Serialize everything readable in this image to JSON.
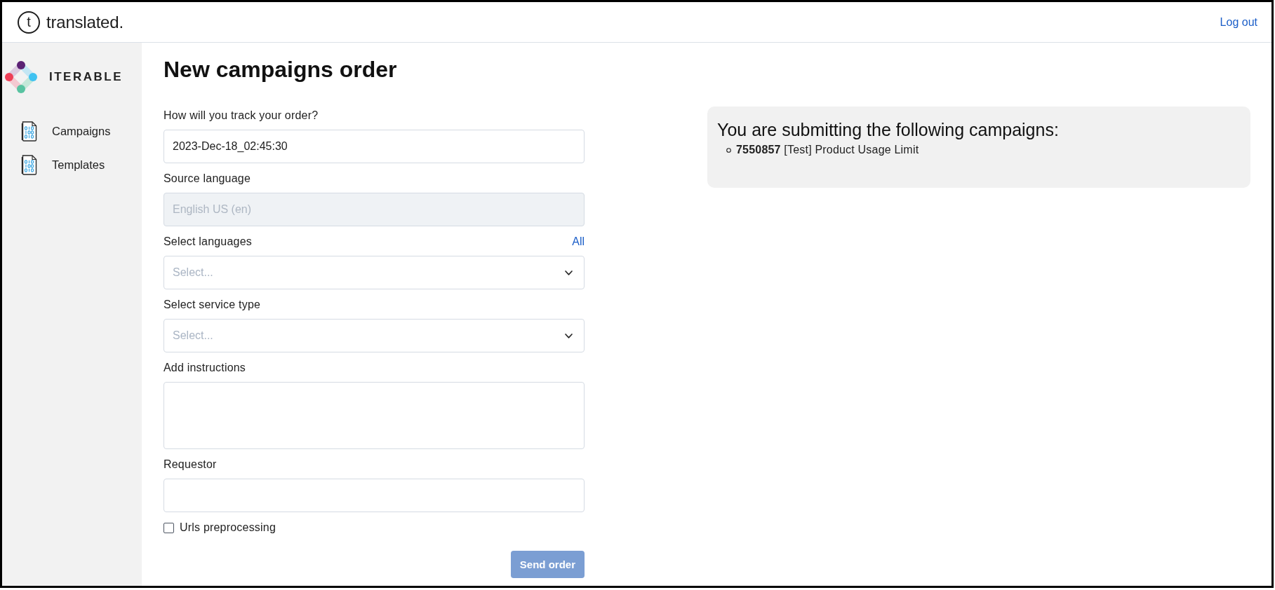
{
  "header": {
    "logo_mark": "t",
    "logo_text": "translated.",
    "logout": "Log out"
  },
  "sidebar": {
    "brand": "ITERABLE",
    "items": [
      {
        "label": "Campaigns",
        "selected": false
      },
      {
        "label": "Templates",
        "selected": false
      }
    ]
  },
  "title": "New campaigns order",
  "form": {
    "fields": [
      {
        "kind": "text",
        "label": "How will you track your order?",
        "value": "2023-Dec-18_02:45:30",
        "disabled": false
      },
      {
        "kind": "text",
        "label": "Source language",
        "value": "English US (en)",
        "disabled": true
      },
      {
        "kind": "select",
        "label": "Select languages",
        "action": "All",
        "placeholder": "Select...",
        "disabled": false
      },
      {
        "kind": "select",
        "label": "Select service type",
        "placeholder": "Select...",
        "disabled": false
      },
      {
        "kind": "textarea",
        "label": "Add instructions",
        "disabled": false
      },
      {
        "kind": "text",
        "label": "Requestor",
        "disabled": false
      }
    ],
    "checkbox": {
      "label": "Urls preprocessing",
      "checked": false
    },
    "submit": {
      "label": "Send order",
      "disabled": true
    }
  },
  "summary": {
    "title": "You are submitting the following campaigns:",
    "items": [
      "**7550857** [Test] Product Usage Limit"
    ]
  }
}
